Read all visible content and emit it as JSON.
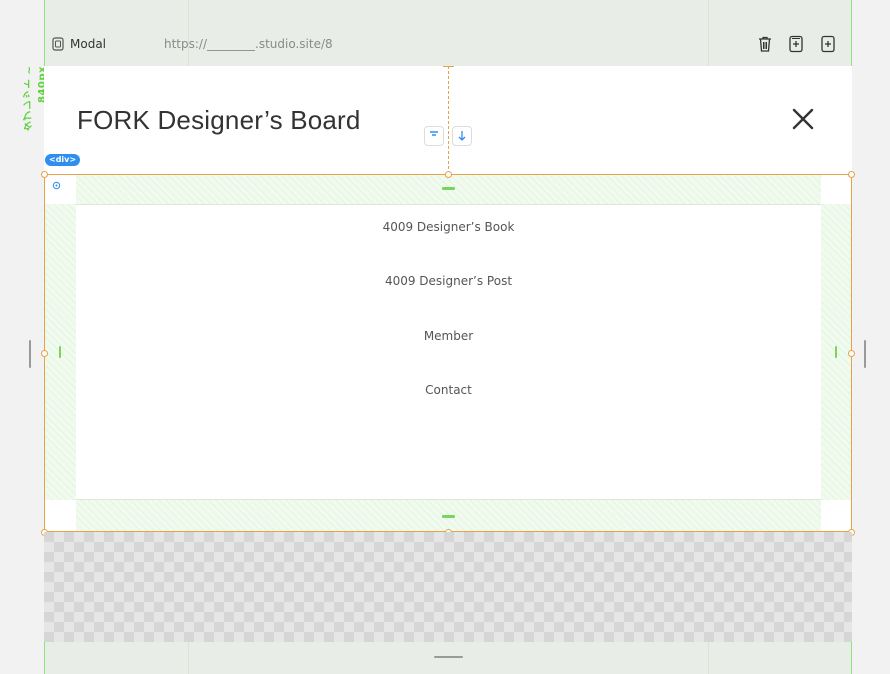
{
  "topbar": {
    "modal_label": "Modal",
    "url": "https://________.studio.site/8"
  },
  "side_label": "タブレット ~ 840px",
  "modal": {
    "title": "FORK Designer’s Board",
    "div_tag": "<div>"
  },
  "menu": {
    "items": [
      {
        "label": "4009 Designer’s Book"
      },
      {
        "label": "4009 Designer’s Post"
      },
      {
        "label": "Member"
      },
      {
        "label": "Contact"
      }
    ]
  },
  "colors": {
    "selection": "#e8a24a",
    "guide": "#8ee47a",
    "tag": "#2f8ff0",
    "text": "#333333"
  },
  "icons": [
    "modal-icon",
    "trash-icon",
    "add-page-icon",
    "add-icon",
    "close-icon",
    "align-top-icon",
    "arrow-down-icon"
  ]
}
